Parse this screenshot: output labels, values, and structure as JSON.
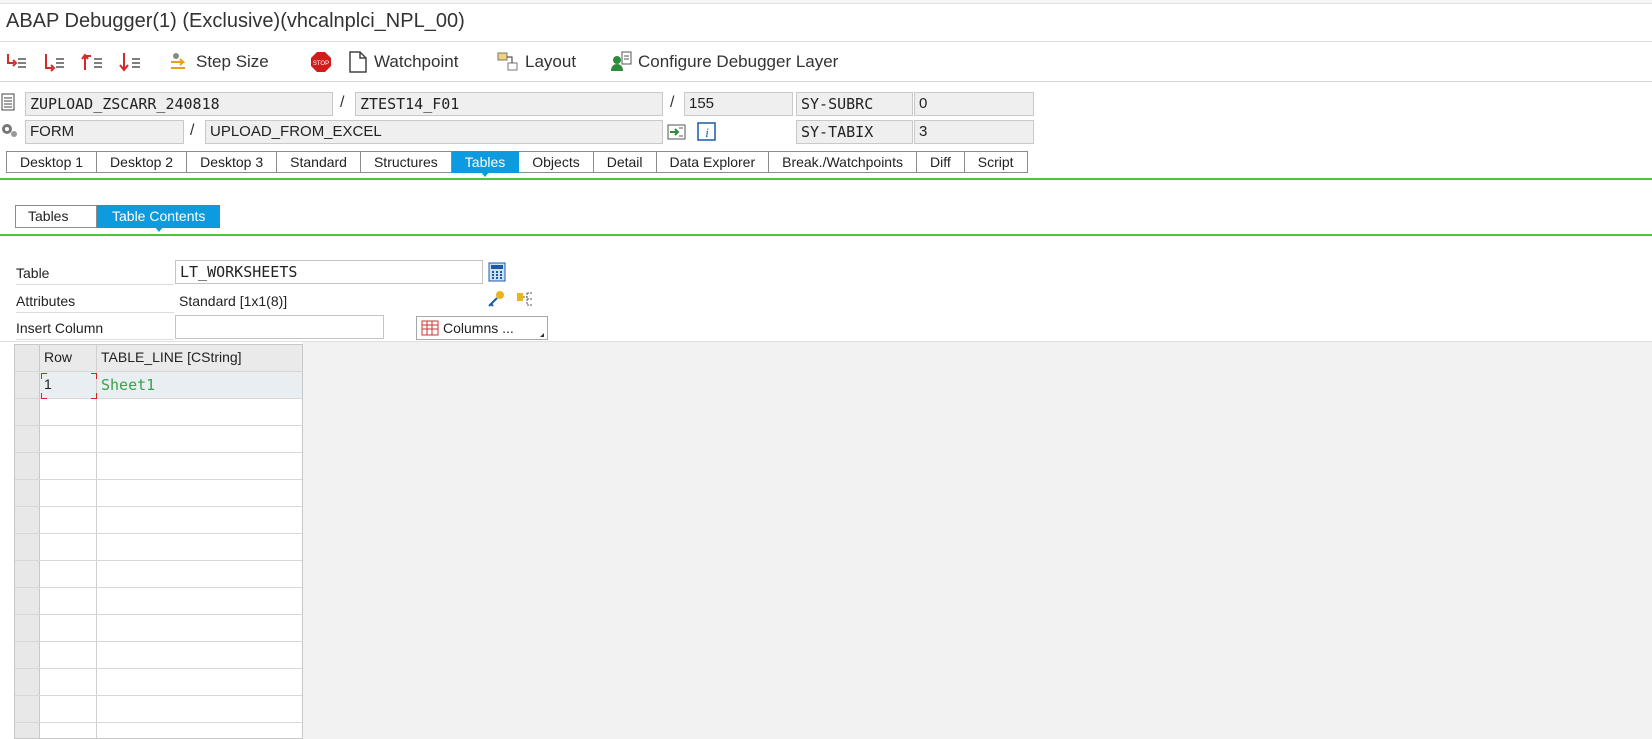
{
  "window": {
    "title": "ABAP Debugger(1)  (Exclusive)(vhcalnplci_NPL_00)"
  },
  "toolbar": {
    "step_icons": [
      "step-into-icon",
      "step-over-icon",
      "step-return-icon",
      "continue-icon"
    ],
    "step_size_label": "Step Size",
    "watchpoint_label": "Watchpoint",
    "layout_label": "Layout",
    "configure_label": "Configure Debugger Layer"
  },
  "context": {
    "program": "ZUPLOAD_ZSCARR_240818",
    "include": "ZTEST14_F01",
    "line": "155",
    "event_type": "FORM",
    "event": "UPLOAD_FROM_EXCEL",
    "sy_subrc_label": "SY-SUBRC",
    "sy_subrc_value": "0",
    "sy_tabix_label": "SY-TABIX",
    "sy_tabix_value": "3",
    "separator": "/"
  },
  "tabs": [
    "Desktop 1",
    "Desktop 2",
    "Desktop 3",
    "Standard",
    "Structures",
    "Tables",
    "Objects",
    "Detail",
    "Data Explorer",
    "Break./Watchpoints",
    "Diff",
    "Script"
  ],
  "active_tab": "Tables",
  "subtabs": [
    "Tables",
    "Table Contents"
  ],
  "active_subtab": "Table Contents",
  "form": {
    "table_label": "Table",
    "table_value": "LT_WORKSHEETS",
    "attributes_label": "Attributes",
    "attributes_value": "Standard [1x1(8)]",
    "insert_column_label": "Insert Column",
    "insert_column_value": "",
    "columns_button": "Columns ..."
  },
  "grid": {
    "headers": [
      "Row",
      "TABLE_LINE [CString]"
    ],
    "rows": [
      {
        "row": "1",
        "value": "Sheet1"
      }
    ],
    "empty_rows": 13
  },
  "colors": {
    "accent": "#0d9adf",
    "green_line": "#52c241",
    "value_green": "#3aa14a"
  }
}
